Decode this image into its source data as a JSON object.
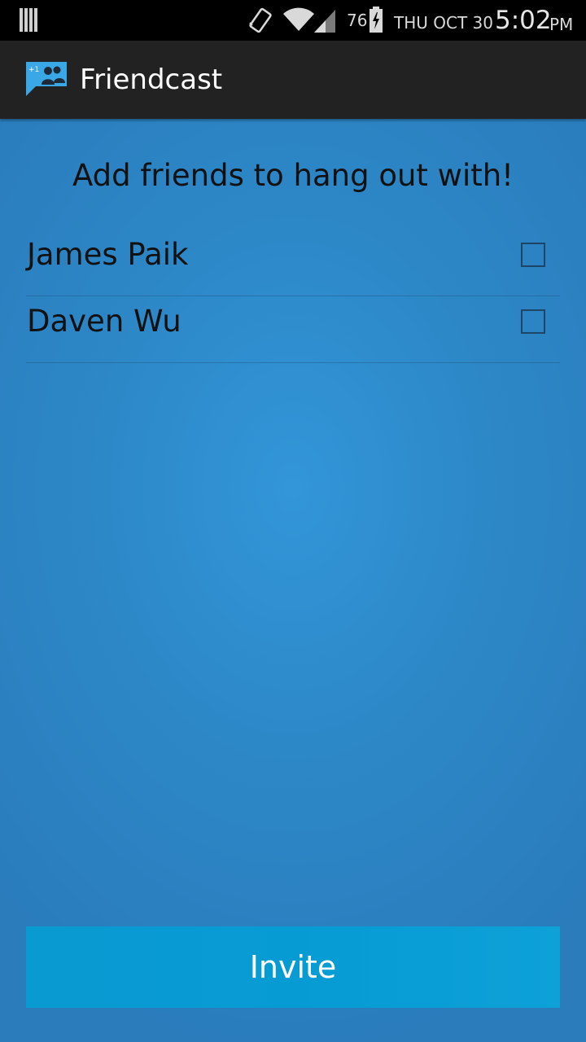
{
  "status_bar": {
    "battery_level": "76",
    "date": "THU OCT 30",
    "time": "5:02",
    "ampm": "PM",
    "icons": [
      "notification-bars-icon",
      "vibrate-icon",
      "wifi-icon",
      "signal-icon",
      "battery-charging-icon"
    ]
  },
  "action_bar": {
    "title": "Friendcast",
    "app_icon": "friendcast-app-icon",
    "app_icon_badge": "+1"
  },
  "main": {
    "heading": "Add friends to hang out with!",
    "friends": [
      {
        "name": "James Paik",
        "checked": false
      },
      {
        "name": "Daven Wu",
        "checked": false
      }
    ],
    "invite_label": "Invite"
  },
  "colors": {
    "background": "#2d88c8",
    "action_bar": "#222222",
    "status_bar": "#000000",
    "button": "#079bd4"
  }
}
